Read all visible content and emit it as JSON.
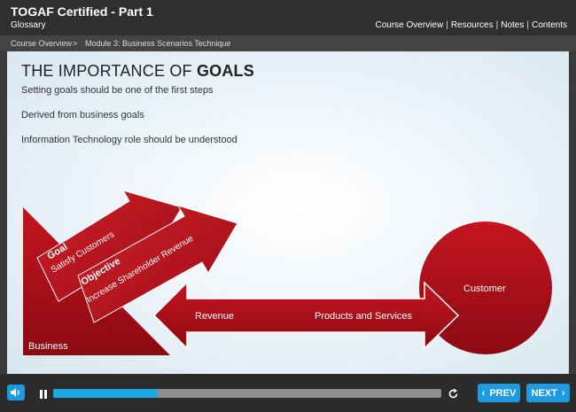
{
  "header": {
    "title": "TOGAF Certified - Part 1",
    "glossary": "Glossary",
    "links": [
      "Course Overview",
      "Resources",
      "Notes",
      "Contents"
    ],
    "separator": "|"
  },
  "breadcrumb": {
    "items": [
      "Course Overview",
      "Module 3: Business Scenarios Technique"
    ],
    "separator": ">"
  },
  "slide": {
    "heading_prefix": "THE IMPORTANCE OF ",
    "heading_bold": "GOALS",
    "bullets": [
      "Setting goals should be one of the first steps",
      "Derived from business goals",
      "Information Technology role should be understood"
    ],
    "diagram": {
      "goal_title": "Goal",
      "goal_text": "Satisfy Customers",
      "objective_title": "Objective",
      "objective_text": "Increase Shareholder Revenue",
      "revenue": "Revenue",
      "products": "Products and Services",
      "business": "Business",
      "customer": "Customer"
    }
  },
  "player": {
    "progress": 0.27,
    "prev_label": "PREV",
    "next_label": "NEXT",
    "icons": [
      "volume-icon",
      "pause-icon",
      "replay-icon"
    ]
  },
  "colors": {
    "accent": "#1e9be0",
    "red": "#b8101c",
    "topbar": "#2f2f2f"
  }
}
